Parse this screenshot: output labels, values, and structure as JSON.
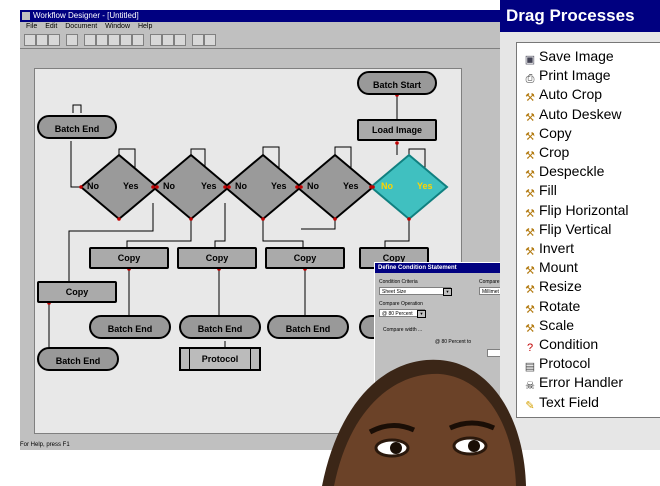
{
  "app": {
    "title": "Workflow Designer - [Untitled]",
    "menus": [
      "File",
      "Edit",
      "Document",
      "Window",
      "Help"
    ],
    "status_text": "For Help, press F1"
  },
  "diagram": {
    "start": "Batch Start",
    "load": "Load Image",
    "batch_end": "Batch End",
    "copy": "Copy",
    "protocol": "Protocol",
    "no": "No",
    "yes": "Yes"
  },
  "dialog": {
    "title": "Define Condition Statement",
    "condition_criteria_label": "Condition Criteria",
    "condition_criteria_value": "Sheet Size",
    "compare_label": "Compare",
    "compare_value": "Millimet",
    "compare_operation_label": "Compare Operation",
    "compare_operation_value": "@ 80 Percent",
    "compare_width_label": "Compare width ...",
    "width_note": "@ 80 Percent to"
  },
  "palette": {
    "title": "Drag Processes",
    "items": [
      {
        "label": "Save Image",
        "icon": "floppy-icon"
      },
      {
        "label": "Print Image",
        "icon": "printer-icon"
      },
      {
        "label": "Auto Crop",
        "icon": "tools-icon"
      },
      {
        "label": "Auto Deskew",
        "icon": "tools-icon"
      },
      {
        "label": "Copy",
        "icon": "tools-icon"
      },
      {
        "label": "Crop",
        "icon": "tools-icon"
      },
      {
        "label": "Despeckle",
        "icon": "tools-icon"
      },
      {
        "label": "Fill",
        "icon": "tools-icon"
      },
      {
        "label": "Flip Horizontal",
        "icon": "tools-icon"
      },
      {
        "label": "Flip Vertical",
        "icon": "tools-icon"
      },
      {
        "label": "Invert",
        "icon": "tools-icon"
      },
      {
        "label": "Mount",
        "icon": "tools-icon"
      },
      {
        "label": "Resize",
        "icon": "tools-icon"
      },
      {
        "label": "Rotate",
        "icon": "tools-icon"
      },
      {
        "label": "Scale",
        "icon": "tools-icon"
      },
      {
        "label": "Condition",
        "icon": "question-icon"
      },
      {
        "label": "Protocol",
        "icon": "scroll-icon"
      },
      {
        "label": "Error Handler",
        "icon": "skull-icon"
      },
      {
        "label": "Text Field",
        "icon": "note-icon"
      }
    ]
  },
  "colors": {
    "titlebar": "#000080",
    "node_fill": "#999999",
    "highlight_diamond": "#40c0c0",
    "connector_dot": "#c00000"
  }
}
